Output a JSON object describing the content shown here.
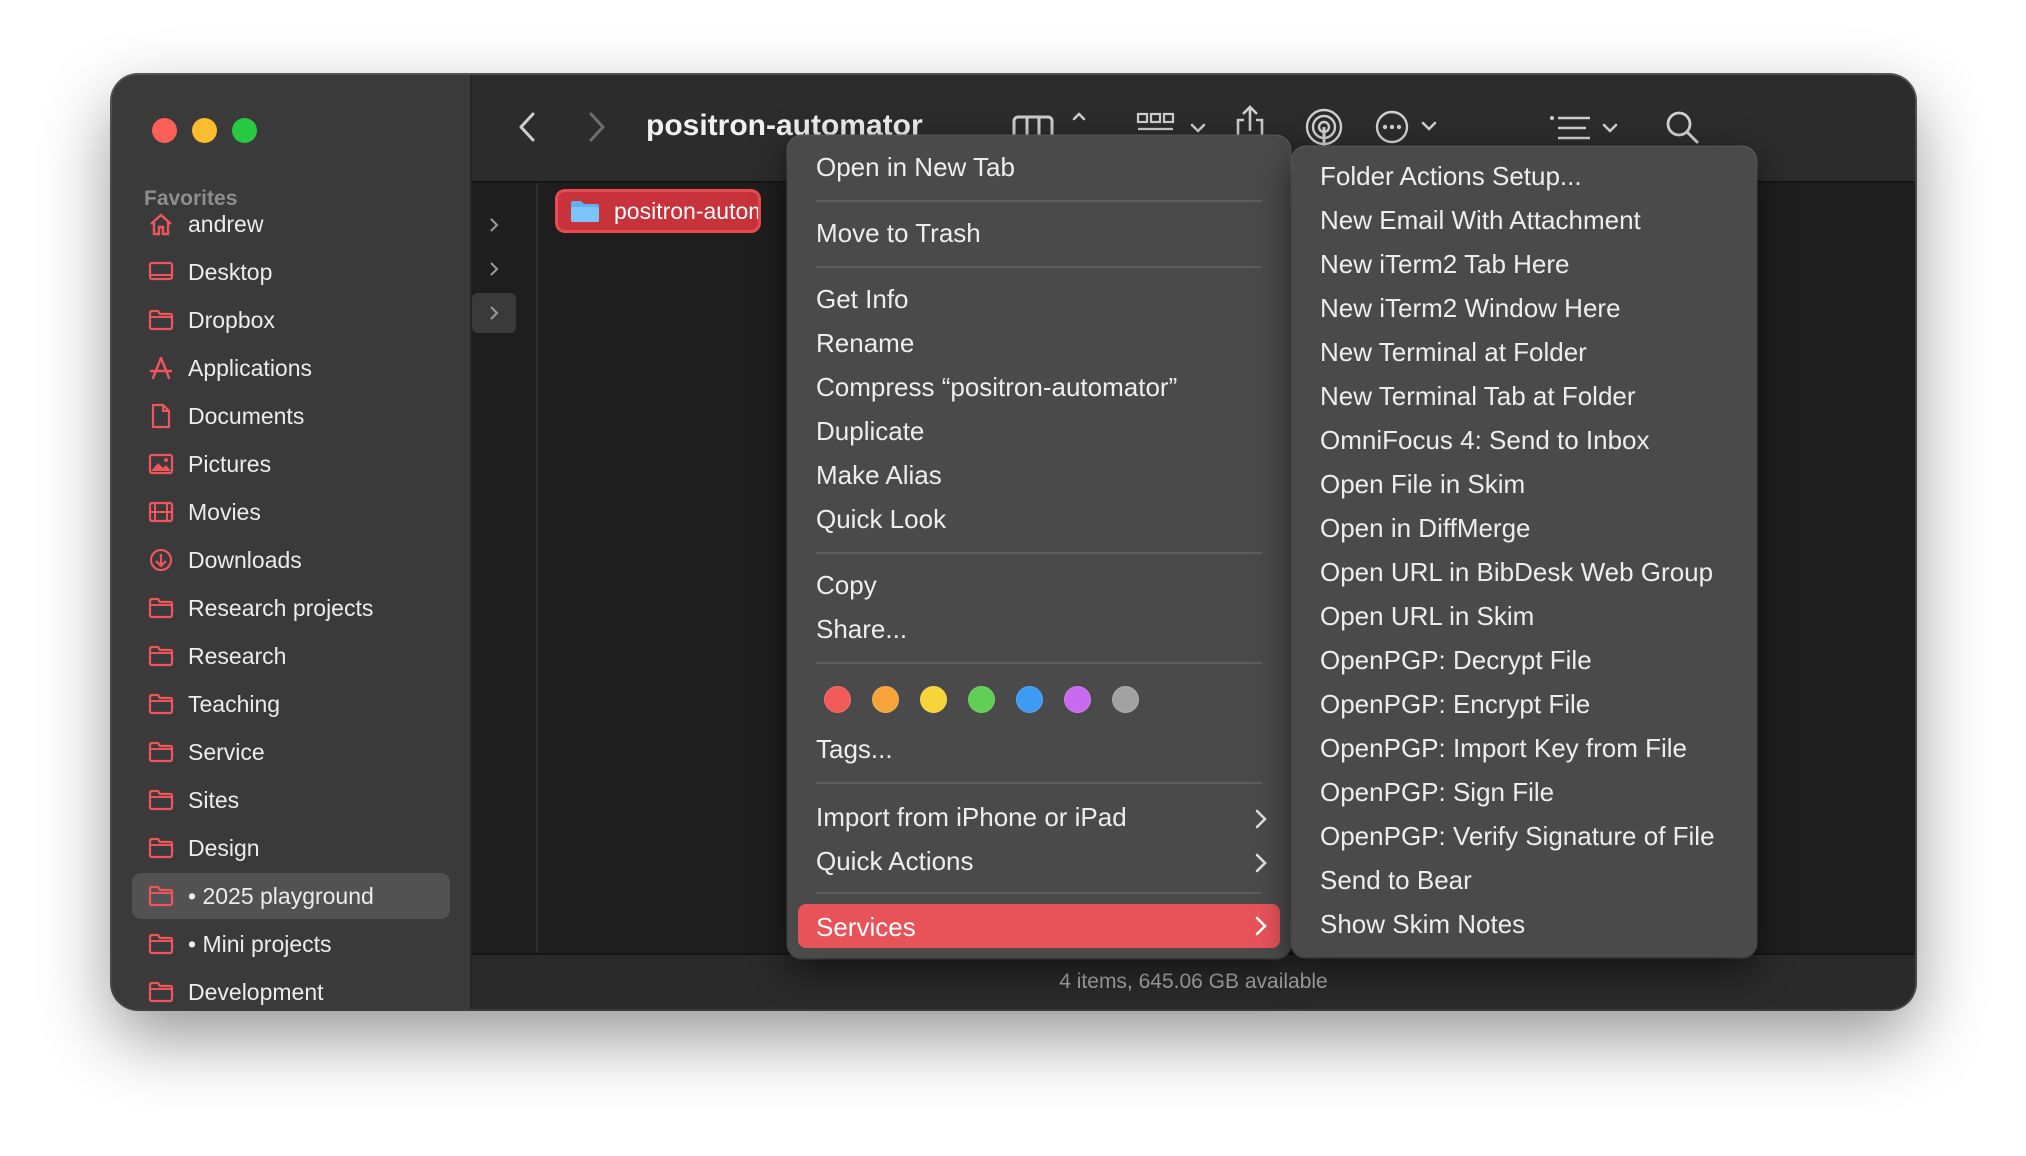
{
  "window": {
    "title": "positron-automator",
    "status": "4 items, 645.06 GB available"
  },
  "sidebar": {
    "header": "Favorites",
    "items": [
      {
        "label": "andrew",
        "icon": "home-icon"
      },
      {
        "label": "Desktop",
        "icon": "desktop-icon"
      },
      {
        "label": "Dropbox",
        "icon": "folder-icon"
      },
      {
        "label": "Applications",
        "icon": "applications-icon"
      },
      {
        "label": "Documents",
        "icon": "document-icon"
      },
      {
        "label": "Pictures",
        "icon": "pictures-icon"
      },
      {
        "label": "Movies",
        "icon": "movies-icon"
      },
      {
        "label": "Downloads",
        "icon": "downloads-icon"
      },
      {
        "label": "Research projects",
        "icon": "folder-icon"
      },
      {
        "label": "Research",
        "icon": "folder-icon"
      },
      {
        "label": "Teaching",
        "icon": "folder-icon"
      },
      {
        "label": "Service",
        "icon": "folder-icon"
      },
      {
        "label": "Sites",
        "icon": "folder-icon"
      },
      {
        "label": "Design",
        "icon": "folder-icon"
      },
      {
        "label": "• 2025 playground",
        "icon": "folder-icon",
        "selected": true
      },
      {
        "label": "• Mini projects",
        "icon": "folder-icon"
      },
      {
        "label": "Development",
        "icon": "folder-icon"
      }
    ]
  },
  "toolbar": {
    "icons": [
      "back-icon",
      "forward-icon",
      "column-view-icon",
      "group-icon",
      "share-icon",
      "airdrop-icon",
      "more-actions-icon",
      "list-sort-icon",
      "search-icon"
    ]
  },
  "browser": {
    "selected_item": "positron-autom"
  },
  "context_menu": {
    "items": {
      "open_new_tab": "Open in New Tab",
      "move_to_trash": "Move to Trash",
      "get_info": "Get Info",
      "rename": "Rename",
      "compress": "Compress “positron-automator”",
      "duplicate": "Duplicate",
      "make_alias": "Make Alias",
      "quick_look": "Quick Look",
      "copy": "Copy",
      "share": "Share...",
      "tags": "Tags...",
      "import_iphone": "Import from iPhone or iPad",
      "quick_actions": "Quick Actions",
      "services": "Services"
    },
    "tag_colors": [
      "#f25b58",
      "#f7a33b",
      "#f7d43a",
      "#5fcf54",
      "#3d9bf6",
      "#c86af0",
      "#a2a2a2"
    ],
    "highlight_color": "#e8535a"
  },
  "services_submenu": {
    "items": [
      "Folder Actions Setup...",
      "New Email With Attachment",
      "New iTerm2 Tab Here",
      "New iTerm2 Window Here",
      "New Terminal at Folder",
      "New Terminal Tab at Folder",
      "OmniFocus 4: Send to Inbox",
      "Open File in Skim",
      "Open in DiffMerge",
      "Open URL in BibDesk Web Group",
      "Open URL in Skim",
      "OpenPGP: Decrypt File",
      "OpenPGP: Encrypt File",
      "OpenPGP: Import Key from File",
      "OpenPGP: Sign File",
      "OpenPGP: Verify Signature of File",
      "Send to Bear",
      "Show Skim Notes"
    ]
  }
}
